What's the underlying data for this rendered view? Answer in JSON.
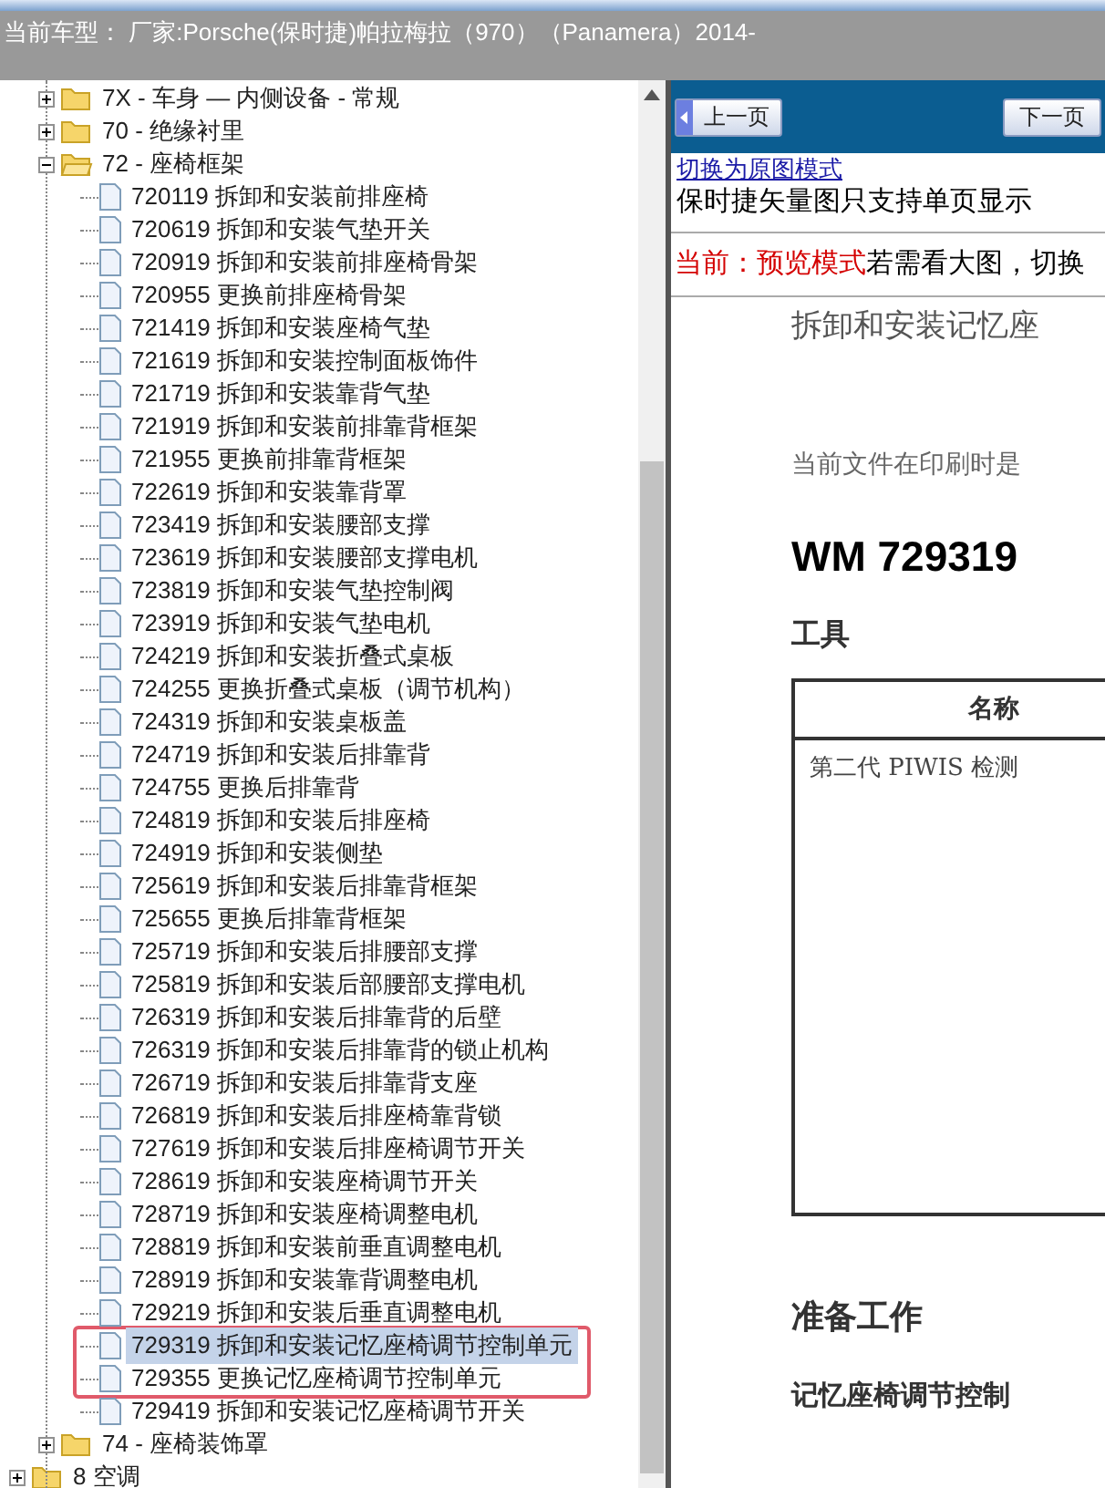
{
  "header": {
    "vehicle": "当前车型： 厂家:Porsche(保时捷)帕拉梅拉（970）（Panamera）2014-"
  },
  "tree": {
    "group_children": [
      {
        "label": "7X - 车身 — 内侧设备 - 常规",
        "expanded": false
      },
      {
        "label": "70 - 绝缘衬里",
        "expanded": false
      },
      {
        "label": "72 - 座椅框架",
        "expanded": true,
        "children": [
          {
            "label": "720119 拆卸和安装前排座椅",
            "selected": false,
            "marked": false
          },
          {
            "label": "720619 拆卸和安装气垫开关",
            "selected": false,
            "marked": false
          },
          {
            "label": "720919 拆卸和安装前排座椅骨架",
            "selected": false,
            "marked": false
          },
          {
            "label": "720955 更换前排座椅骨架",
            "selected": false,
            "marked": false
          },
          {
            "label": "721419 拆卸和安装座椅气垫",
            "selected": false,
            "marked": false
          },
          {
            "label": "721619 拆卸和安装控制面板饰件",
            "selected": false,
            "marked": false
          },
          {
            "label": "721719 拆卸和安装靠背气垫",
            "selected": false,
            "marked": false
          },
          {
            "label": "721919 拆卸和安装前排靠背框架",
            "selected": false,
            "marked": false
          },
          {
            "label": "721955 更换前排靠背框架",
            "selected": false,
            "marked": false
          },
          {
            "label": "722619 拆卸和安装靠背罩",
            "selected": false,
            "marked": false
          },
          {
            "label": "723419 拆卸和安装腰部支撑",
            "selected": false,
            "marked": false
          },
          {
            "label": "723619 拆卸和安装腰部支撑电机",
            "selected": false,
            "marked": false
          },
          {
            "label": "723819 拆卸和安装气垫控制阀",
            "selected": false,
            "marked": false
          },
          {
            "label": "723919 拆卸和安装气垫电机",
            "selected": false,
            "marked": false
          },
          {
            "label": "724219 拆卸和安装折叠式桌板",
            "selected": false,
            "marked": false
          },
          {
            "label": "724255 更换折叠式桌板（调节机构）",
            "selected": false,
            "marked": false
          },
          {
            "label": "724319 拆卸和安装桌板盖",
            "selected": false,
            "marked": false
          },
          {
            "label": "724719 拆卸和安装后排靠背",
            "selected": false,
            "marked": false
          },
          {
            "label": "724755 更换后排靠背",
            "selected": false,
            "marked": false
          },
          {
            "label": "724819 拆卸和安装后排座椅",
            "selected": false,
            "marked": false
          },
          {
            "label": "724919 拆卸和安装侧垫",
            "selected": false,
            "marked": false
          },
          {
            "label": "725619 拆卸和安装后排靠背框架",
            "selected": false,
            "marked": false
          },
          {
            "label": "725655 更换后排靠背框架",
            "selected": false,
            "marked": false
          },
          {
            "label": "725719 拆卸和安装后排腰部支撑",
            "selected": false,
            "marked": false
          },
          {
            "label": "725819 拆卸和安装后部腰部支撑电机",
            "selected": false,
            "marked": false
          },
          {
            "label": "726319 拆卸和安装后排靠背的后壁",
            "selected": false,
            "marked": false
          },
          {
            "label": "726319 拆卸和安装后排靠背的锁止机构",
            "selected": false,
            "marked": false
          },
          {
            "label": "726719 拆卸和安装后排靠背支座",
            "selected": false,
            "marked": false
          },
          {
            "label": "726819 拆卸和安装后排座椅靠背锁",
            "selected": false,
            "marked": false
          },
          {
            "label": "727619 拆卸和安装后排座椅调节开关",
            "selected": false,
            "marked": false
          },
          {
            "label": "728619 拆卸和安装座椅调节开关",
            "selected": false,
            "marked": false
          },
          {
            "label": "728719 拆卸和安装座椅调整电机",
            "selected": false,
            "marked": false
          },
          {
            "label": "728819 拆卸和安装前垂直调整电机",
            "selected": false,
            "marked": false
          },
          {
            "label": "728919 拆卸和安装靠背调整电机",
            "selected": false,
            "marked": false
          },
          {
            "label": "729219 拆卸和安装后垂直调整电机",
            "selected": false,
            "marked": false
          },
          {
            "label": "729319 拆卸和安装记忆座椅调节控制单元",
            "selected": true,
            "marked": true
          },
          {
            "label": "729355 更换记忆座椅调节控制单元",
            "selected": false,
            "marked": true
          },
          {
            "label": "729419 拆卸和安装记忆座椅调节开关",
            "selected": false,
            "marked": false
          }
        ]
      },
      {
        "label": "74 - 座椅装饰罩",
        "expanded": false
      }
    ],
    "items": [
      {
        "label": "8 空调",
        "expanded": false
      }
    ]
  },
  "toolbar": {
    "prev": "上一页",
    "next": "下一页"
  },
  "viewer": {
    "link": "切换为原图模式",
    "note": "保时捷矢量图只支持单页显示",
    "mode_label": "当前：预览模式",
    "mode_hint": "若需看大图，切换",
    "doc": {
      "title": "拆卸和安装记忆座",
      "print_note": "当前文件在印刷时是",
      "heading": "WM 729319",
      "tools_heading": "工具",
      "table": {
        "columns": [
          "名称"
        ],
        "rows": [
          [
            "第二代 PIWIS 检测"
          ]
        ]
      },
      "prep_heading": "准备工作",
      "prep_text": "记忆座椅调节控制"
    }
  }
}
